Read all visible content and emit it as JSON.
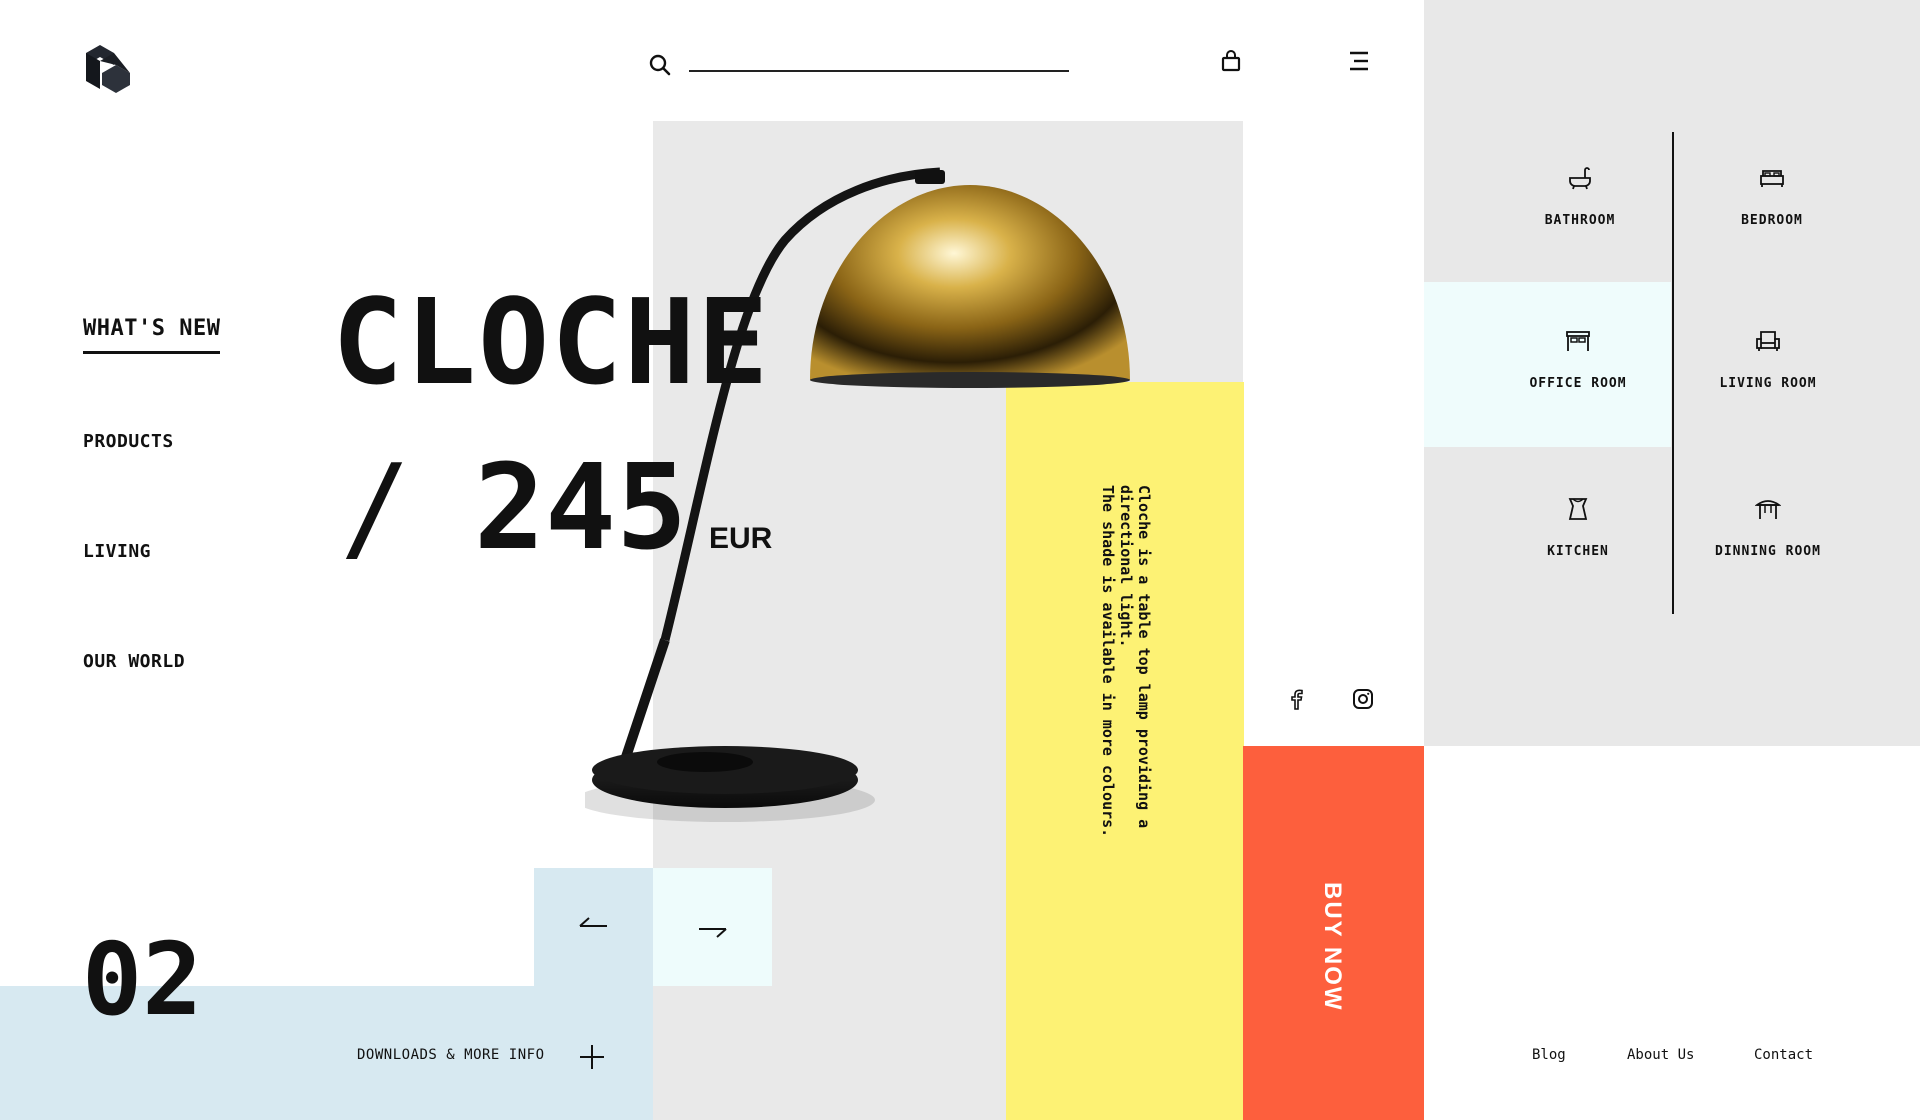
{
  "header": {
    "search_placeholder": "",
    "icons": [
      "logo",
      "search-icon",
      "bag-icon",
      "menu-icon"
    ]
  },
  "nav": {
    "items": [
      {
        "label": "WHAT'S NEW",
        "active": true
      },
      {
        "label": "PRODUCTS"
      },
      {
        "label": "LIVING"
      },
      {
        "label": "OUR WORLD"
      }
    ]
  },
  "product": {
    "name": "CLOCHE",
    "slash": "/",
    "price": "245",
    "currency": "EUR",
    "description": "Cloche is a table top lamp providing a directional light.\nThe shade is available in more colours.",
    "buy_label": "BUY NOW"
  },
  "slider": {
    "number": "02",
    "prev_icon": "arrow-left-icon",
    "next_icon": "arrow-right-icon"
  },
  "downloads": {
    "label": "DOWNLOADS & MORE INFO",
    "icon": "plus-icon"
  },
  "social": [
    "facebook-icon",
    "instagram-icon"
  ],
  "categories": [
    {
      "label": "BATHROOM",
      "icon": "bathtub-icon"
    },
    {
      "label": "BEDROOM",
      "icon": "bed-icon"
    },
    {
      "label": "OFFICE ROOM",
      "icon": "desk-icon",
      "active": true
    },
    {
      "label": "LIVING ROOM",
      "icon": "armchair-icon"
    },
    {
      "label": "KITCHEN",
      "icon": "pot-icon"
    },
    {
      "label": "DINNING ROOM",
      "icon": "table-icon"
    }
  ],
  "footer": {
    "links": [
      "Blog",
      "About Us",
      "Contact"
    ]
  },
  "colors": {
    "gray": "#e9e9e9",
    "light_blue": "#d7e9f1",
    "cyan": "#eefcfc",
    "yellow": "#fdf274",
    "orange": "#fd5f3d",
    "panel": "#e8e8e8"
  }
}
